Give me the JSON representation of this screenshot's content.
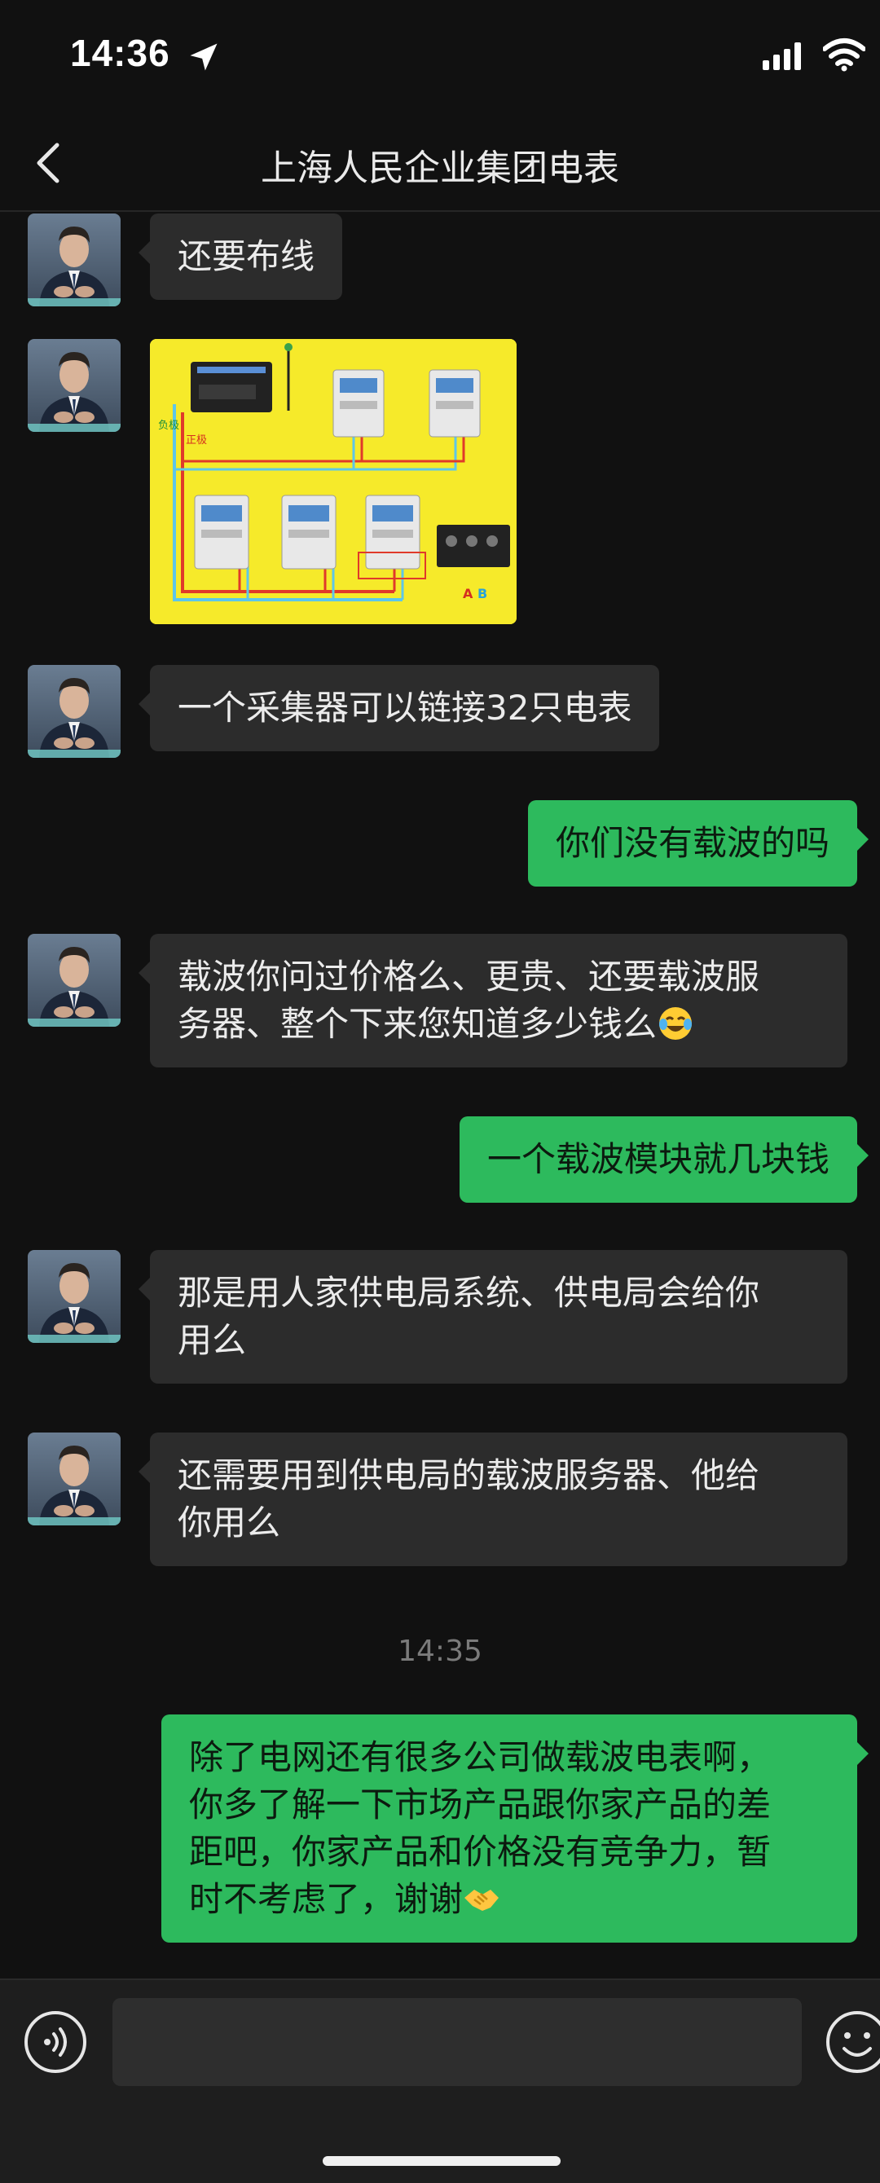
{
  "status_bar": {
    "time": "14:36"
  },
  "nav": {
    "title": "上海人民企业集团电表"
  },
  "messages": [
    {
      "text": "还要布线"
    },
    {
      "image_alt": "meter wiring diagram"
    },
    {
      "text": "一个采集器可以链接32只电表"
    },
    {
      "text": "你们没有载波的吗"
    },
    {
      "text_l1": "载波你问过价格么、更贵、还要载波服",
      "text_l2": "务器、整个下来您知道多少钱么",
      "emoji": "laughing-tears-emoji"
    },
    {
      "text": "一个载波模块就几块钱"
    },
    {
      "text_l1": "那是用人家供电局系统、供电局会给你",
      "text_l2": "用么"
    },
    {
      "text_l1": "还需要用到供电局的载波服务器、他给",
      "text_l2": "你用么"
    },
    {
      "timestamp": "14:35"
    },
    {
      "text_l1": "除了电网还有很多公司做载波电表啊，",
      "text_l2": "你多了解一下市场产品跟你家产品的差",
      "text_l3": "距吧，你家产品和价格没有竞争力，暂",
      "text_l4": "时不考虑了，谢谢",
      "emoji": "handshake-emoji"
    }
  ],
  "wiring_image": {
    "labels": {
      "negative": "负极",
      "positive": "正极",
      "a": "A",
      "b": "B"
    }
  },
  "input": {
    "placeholder": ""
  },
  "colors": {
    "background": "#111111",
    "incoming_bubble": "#2c2c2c",
    "outgoing_bubble": "#2dba5d",
    "accent": "#2dba5d"
  }
}
